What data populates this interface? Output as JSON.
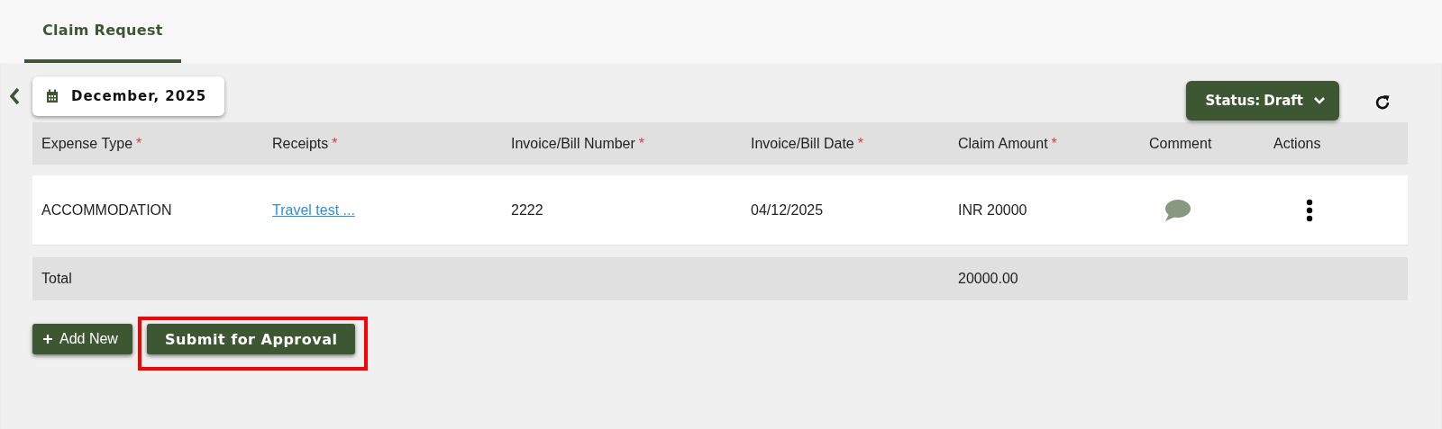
{
  "tabs": [
    {
      "label": "Claim Request",
      "selected": true
    }
  ],
  "month_picker": {
    "value": "December, 2025"
  },
  "status_filter": {
    "label": "Status:",
    "value": "Draft"
  },
  "table": {
    "columns": [
      {
        "label": "Expense Type",
        "required_mark": "*"
      },
      {
        "label": "Receipts",
        "required_mark": "*"
      },
      {
        "label": "Invoice/Bill Number",
        "required_mark": "*"
      },
      {
        "label": "Invoice/Bill Date",
        "required_mark": "*"
      },
      {
        "label": "Claim Amount",
        "required_mark": "*"
      },
      {
        "label": "Comment"
      },
      {
        "label": "Actions"
      }
    ],
    "rows": [
      {
        "expense_type": "ACCOMMODATION",
        "receipt": "Travel test ...",
        "invoice_number": "2222",
        "invoice_date": "04/12/2025",
        "claim_amount": "INR 20000"
      }
    ],
    "total": {
      "label": "Total",
      "amount": "20000.00"
    }
  },
  "buttons": [
    {
      "label": "Add New",
      "kind": "add",
      "highlighted": false
    },
    {
      "label": "Submit for Approval",
      "kind": "submit",
      "highlighted": true
    }
  ]
}
